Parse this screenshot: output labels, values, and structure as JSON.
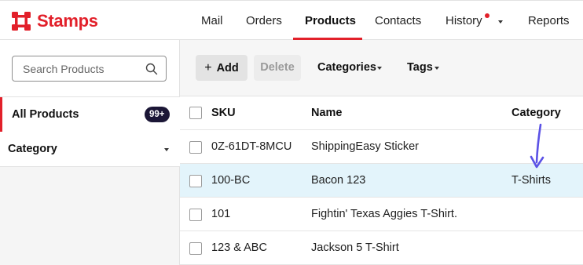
{
  "app": {
    "name": "Stamps",
    "brand_color": "#e2202a"
  },
  "nav": {
    "items": [
      {
        "label": "Mail"
      },
      {
        "label": "Orders"
      },
      {
        "label": "Products",
        "active": true
      },
      {
        "label": "Contacts"
      },
      {
        "label": "History",
        "has_notification": true
      },
      {
        "label": "Reports"
      }
    ]
  },
  "sidebar": {
    "search_placeholder": "Search Products",
    "all_products_label": "All Products",
    "all_products_count": "99+",
    "category_label": "Category"
  },
  "toolbar": {
    "add_label": "Add",
    "delete_label": "Delete",
    "delete_disabled": true,
    "categories_label": "Categories",
    "tags_label": "Tags"
  },
  "table": {
    "columns": [
      "SKU",
      "Name",
      "Category"
    ],
    "rows": [
      {
        "sku": "0Z-61DT-8MCU",
        "name": "ShippingEasy Sticker",
        "category": "",
        "selected": false
      },
      {
        "sku": "100-BC",
        "name": "Bacon 123",
        "category": "T-Shirts",
        "selected": true
      },
      {
        "sku": "101",
        "name": "Fightin' Texas Aggies T-Shirt.",
        "category": "",
        "selected": false
      },
      {
        "sku": "123 & ABC",
        "name": "Jackson 5 T-Shirt",
        "category": "",
        "selected": false
      }
    ]
  },
  "colors": {
    "selected_row": "#e3f4fb",
    "badge": "#1b1636",
    "annotation_arrow": "#5b52e6"
  }
}
